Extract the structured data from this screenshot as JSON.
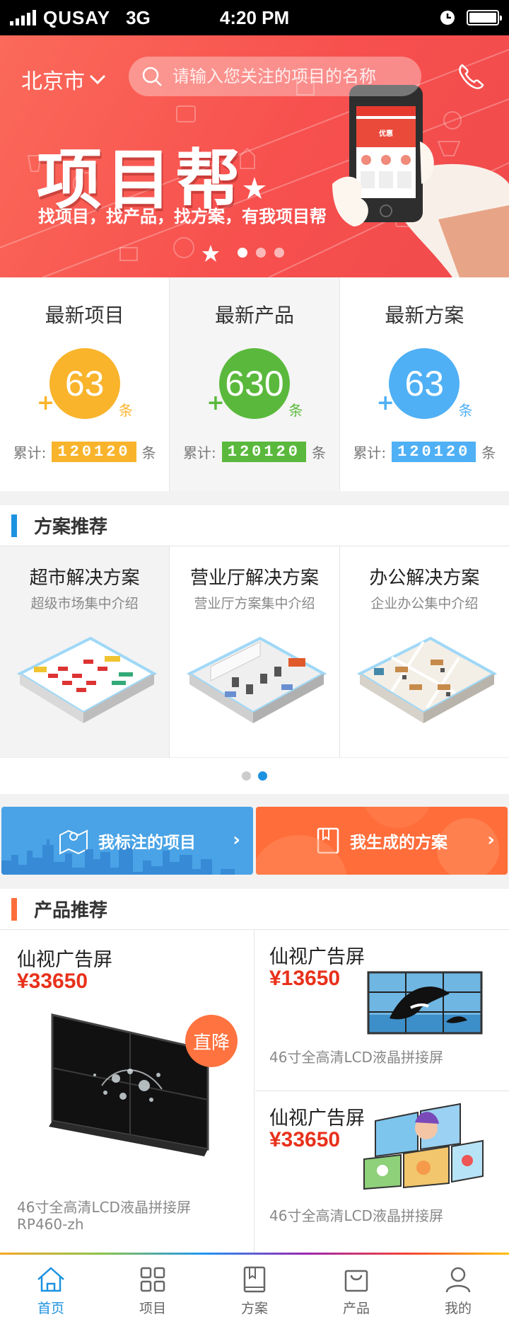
{
  "status_bar": {
    "carrier": "QUSAY",
    "network": "3G",
    "time": "4:20 PM"
  },
  "header": {
    "city": "北京市",
    "search_placeholder": "请输入您关注的项目的名称"
  },
  "banner": {
    "title": "项目帮",
    "subtitle": "找项目，找产品，找方案，有我项目帮",
    "slide_count": 3,
    "active_slide": 0
  },
  "stats": [
    {
      "title": "最新项目",
      "count": "63",
      "plus": "+",
      "unit": "条",
      "total_label": "累计:",
      "total": "120120",
      "total_unit": "条",
      "color": "#f9b42b"
    },
    {
      "title": "最新产品",
      "count": "630",
      "plus": "+",
      "unit": "条",
      "total_label": "累计:",
      "total": "120120",
      "total_unit": "条",
      "color": "#5ab93c"
    },
    {
      "title": "最新方案",
      "count": "63",
      "plus": "+",
      "unit": "条",
      "total_label": "累计:",
      "total": "120120",
      "total_unit": "条",
      "color": "#4fb0f5"
    }
  ],
  "solutions_section": {
    "title": "方案推荐",
    "accent": "#1d92e0",
    "items": [
      {
        "title": "超市解决方案",
        "desc": "超级市场集中介绍"
      },
      {
        "title": "营业厅解决方案",
        "desc": "营业厅方案集中介绍"
      },
      {
        "title": "办公解决方案",
        "desc": "企业办公集中介绍"
      }
    ],
    "page_count": 2,
    "active_page": 1
  },
  "actions": {
    "marked_projects": "我标注的项目",
    "generated_plans": "我生成的方案"
  },
  "products_section": {
    "title": "产品推荐",
    "accent": "#ff6d3a",
    "featured": {
      "name": "仙视广告屏",
      "price": "¥33650",
      "badge": "直降",
      "desc_line1": "46寸全高清LCD液晶拼接屏",
      "desc_line2": "RP460-zh"
    },
    "items": [
      {
        "name": "仙视广告屏",
        "price": "¥13650",
        "desc": "46寸全高清LCD液晶拼接屏"
      },
      {
        "name": "仙视广告屏",
        "price": "¥33650",
        "desc": "46寸全高清LCD液晶拼接屏"
      }
    ]
  },
  "tabbar": [
    {
      "label": "首页",
      "icon": "home-icon",
      "active": true
    },
    {
      "label": "项目",
      "icon": "grid-icon",
      "active": false
    },
    {
      "label": "方案",
      "icon": "book-icon",
      "active": false
    },
    {
      "label": "产品",
      "icon": "bag-icon",
      "active": false
    },
    {
      "label": "我的",
      "icon": "user-icon",
      "active": false
    }
  ],
  "colors": {
    "active_tab": "#1d92e0",
    "price": "#e8311b"
  }
}
